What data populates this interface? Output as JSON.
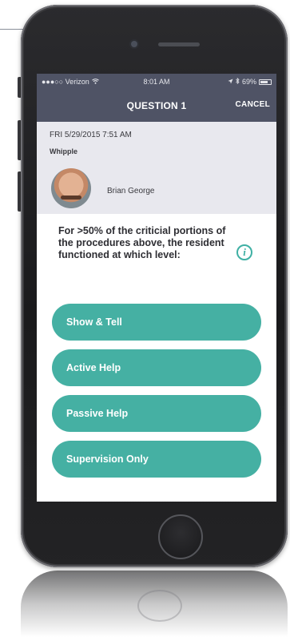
{
  "status_bar": {
    "carrier": "●●●○○ Verizon",
    "time": "8:01 AM",
    "battery": "69%"
  },
  "nav": {
    "title": "QUESTION 1",
    "cancel_label": "CANCEL"
  },
  "info": {
    "date": "FRI 5/29/2015  7:51 AM",
    "procedure": "Whipple",
    "person_name": "Brian George"
  },
  "question": {
    "text": "For >50% of the criticial portions of the procedures above, the resident functioned at which level:"
  },
  "options": [
    {
      "label": "Show & Tell"
    },
    {
      "label": "Active Help"
    },
    {
      "label": "Passive Help"
    },
    {
      "label": "Supervision Only"
    }
  ],
  "colors": {
    "header": "#4f5365",
    "accent": "#45b0a3",
    "panel": "#e8e8ee"
  },
  "icons": {
    "wifi": "wifi-icon",
    "location": "location-arrow-icon",
    "bluetooth": "bluetooth-icon",
    "battery": "battery-icon",
    "info": "info-icon"
  }
}
